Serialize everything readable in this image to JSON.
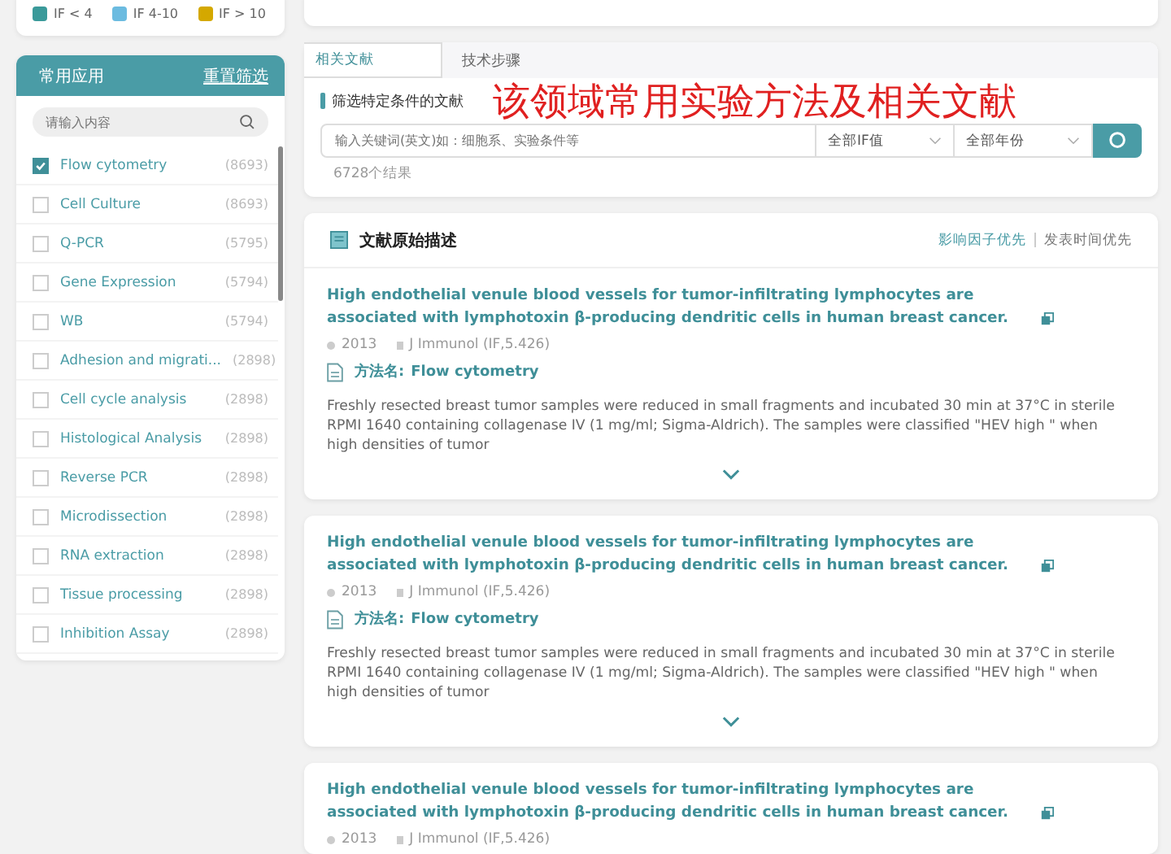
{
  "legend": [
    {
      "label": "IF < 4",
      "color": "#3a9a9a"
    },
    {
      "label": "IF 4-10",
      "color": "#6bbbe0"
    },
    {
      "label": "IF > 10",
      "color": "#d4a800"
    }
  ],
  "sidebar": {
    "title": "常用应用",
    "reset": "重置筛选",
    "search_placeholder": "请输入内容",
    "items": [
      {
        "label": "Flow cytometry",
        "count": "(8693)",
        "checked": true
      },
      {
        "label": "Cell Culture",
        "count": "(8693)",
        "checked": false
      },
      {
        "label": "Q-PCR",
        "count": "(5795)",
        "checked": false
      },
      {
        "label": "Gene Expression",
        "count": "(5794)",
        "checked": false
      },
      {
        "label": "WB",
        "count": "(5794)",
        "checked": false
      },
      {
        "label": "Adhesion and migrati...",
        "count": "(2898)",
        "checked": false
      },
      {
        "label": "Cell cycle analysis",
        "count": "(2898)",
        "checked": false
      },
      {
        "label": "Histological Analysis",
        "count": "(2898)",
        "checked": false
      },
      {
        "label": "Reverse PCR",
        "count": "(2898)",
        "checked": false
      },
      {
        "label": "Microdissection",
        "count": "(2898)",
        "checked": false
      },
      {
        "label": "RNA extraction",
        "count": "(2898)",
        "checked": false
      },
      {
        "label": "Tissue processing",
        "count": "(2898)",
        "checked": false
      },
      {
        "label": "Inhibition Assay",
        "count": "(2898)",
        "checked": false
      }
    ]
  },
  "tabs": [
    {
      "label": "相关文献",
      "selected": true
    },
    {
      "label": "技术步骤",
      "selected": false
    }
  ],
  "annotation": "该领域常用实验方法及相关文献",
  "filter": {
    "heading": "筛选特定条件的文献",
    "placeholder": "输入关键词(英文)如：细胞系、实验条件等",
    "if_select": "全部IF值",
    "year_select": "全部年份",
    "result_count": "6728个结果"
  },
  "results": {
    "title": "文献原始描述",
    "sort_options": [
      {
        "label": "影响因子优先",
        "selected": true
      },
      {
        "label": "发表时间优先",
        "selected": false
      }
    ],
    "articles": [
      {
        "title": "High endothelial venule blood vessels for tumor-infiltrating lymphocytes are associated with lymphotoxin β-producing dendritic cells in human breast cancer.",
        "year": "2013",
        "journal": "J Immunol (IF,5.426)",
        "method_label": "方法名:",
        "method": "Flow cytometry",
        "abstract": "Freshly resected breast tumor samples were reduced in small fragments and incubated 30 min at 37°C in sterile RPMI 1640 containing collagenase IV (1 mg/ml; Sigma-Aldrich). The samples were classified \"HEV high \" when high densities of tumor"
      },
      {
        "title": "High endothelial venule blood vessels for tumor-infiltrating lymphocytes are associated with lymphotoxin β-producing dendritic cells in human breast cancer.",
        "year": "2013",
        "journal": "J Immunol (IF,5.426)",
        "method_label": "方法名:",
        "method": "Flow cytometry",
        "abstract": "Freshly resected breast tumor samples were reduced in small fragments and incubated 30 min at 37°C in sterile RPMI 1640 containing collagenase IV (1 mg/ml; Sigma-Aldrich). The samples were classified \"HEV high \" when high densities of tumor"
      },
      {
        "title": "High endothelial venule blood vessels for tumor-infiltrating lymphocytes are associated with lymphotoxin β-producing dendritic cells in human breast cancer.",
        "year": "2013",
        "journal": "J Immunol (IF,5.426)"
      }
    ]
  }
}
